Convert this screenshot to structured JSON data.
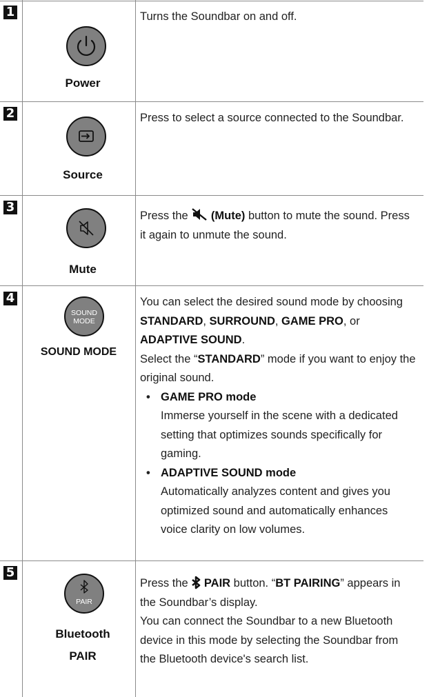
{
  "rows": [
    {
      "number": "1",
      "button_label": "Power",
      "icon": "power-icon",
      "description": "Turns the Soundbar on and off."
    },
    {
      "number": "2",
      "button_label": "Source",
      "icon": "source-input-icon",
      "description": "Press to select a source connected to the Soundbar."
    },
    {
      "number": "3",
      "button_label": "Mute",
      "icon": "mute-icon",
      "description_a": "Press the ",
      "description_b": "(Mute)",
      "description_c": " button to mute the sound. Press it again to unmute the sound."
    },
    {
      "number": "4",
      "button_label": "SOUND MODE",
      "button_text_1": "SOUND",
      "button_text_2": "MODE",
      "p1_a": "You can select the desired sound mode by choosing ",
      "p1_standard": "STANDARD",
      "p1_sep1": ", ",
      "p1_surround": "SURROUND",
      "p1_sep2": ", ",
      "p1_gamepro": "GAME PRO",
      "p1_sep3": ", or ",
      "p1_adaptive": "ADAPTIVE SOUND",
      "p1_end": ".",
      "p2_a": "Select the “",
      "p2_standard": "STANDARD",
      "p2_b": "” mode if you want to enjoy the original sound.",
      "bullets": [
        {
          "dot": "•",
          "title": "GAME PRO mode",
          "text": "Immerse yourself in the scene with a dedicated setting that optimizes sounds specifically for gaming."
        },
        {
          "dot": "•",
          "title": "ADAPTIVE SOUND mode",
          "text": "Automatically analyzes content and gives you optimized sound and automatically enhances voice clarity on low volumes."
        }
      ]
    },
    {
      "number": "5",
      "button_label_1": "Bluetooth",
      "button_label_2": "PAIR",
      "button_text": "PAIR",
      "icon": "bluetooth-icon",
      "p1_a": "Press the ",
      "p1_pair": "PAIR",
      "p1_b": " button. “",
      "p1_bt": "BT PAIRING",
      "p1_c": "” appears in the Soundbar’s display.",
      "p2": "You can connect the Soundbar to a new Bluetooth device in this mode by selecting the Soundbar from the Bluetooth device's search list."
    }
  ]
}
